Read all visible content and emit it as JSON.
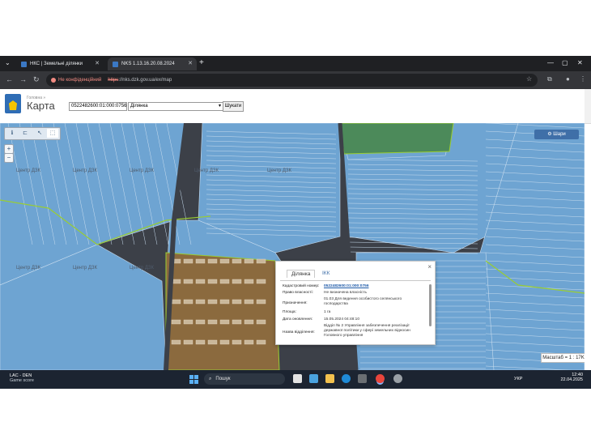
{
  "browser": {
    "tabs": [
      {
        "title": "НКС | Земельні ділянки",
        "active": false
      },
      {
        "title": "NKS 1.13.16.20.08.2024",
        "active": true
      }
    ],
    "security_label": "Не конфіденційний",
    "url_scheme": "https",
    "url_rest": "://nks.dzk.gov.ua/ex/map"
  },
  "header": {
    "breadcrumb": "Головна »",
    "title": "Карта",
    "search_value": "0522482600:01:000:0756",
    "search_type": "Ділянка",
    "search_button": "Шукати"
  },
  "map": {
    "zoom_in": "+",
    "zoom_out": "−",
    "layers_button": "Шари",
    "scale_label": "Масштаб = 1 : 17K",
    "watermark": "Центр ДЗК",
    "colors": {
      "parcel": "#6ea4d2",
      "parcel_outline": "#c9ddef",
      "background": "#3c4048",
      "boundary": "#9acd32",
      "selected_fill": "#8b6a3e",
      "green_area": "#4c8a5a"
    }
  },
  "popup": {
    "tab_parcel": "Ділянка",
    "tab_ikk": "ІКК",
    "rows": [
      {
        "key": "Кадастровий номер:",
        "value": "0522482600:01:000:0756"
      },
      {
        "key": "Право власності:",
        "value": "Не визначена власність"
      },
      {
        "key": "Призначення:",
        "value": "01.03 Для ведення особистого селянського господарства"
      },
      {
        "key": "Площа:",
        "value": "1 га"
      },
      {
        "key": "Дата оновлення:",
        "value": "15.05.2024 04:48:10"
      },
      {
        "key": "Назва відділення:",
        "value": "Відділ № 2 Управління забезпечення реалізації державної політики у сфері земельних відносин Головного управління"
      }
    ],
    "close": "×"
  },
  "taskbar": {
    "widget_title": "LAC - DEN",
    "widget_sub": "Game score",
    "search_placeholder": "Пошук",
    "lang": "УКР",
    "time": "12:40",
    "date": "22.04.2025"
  }
}
